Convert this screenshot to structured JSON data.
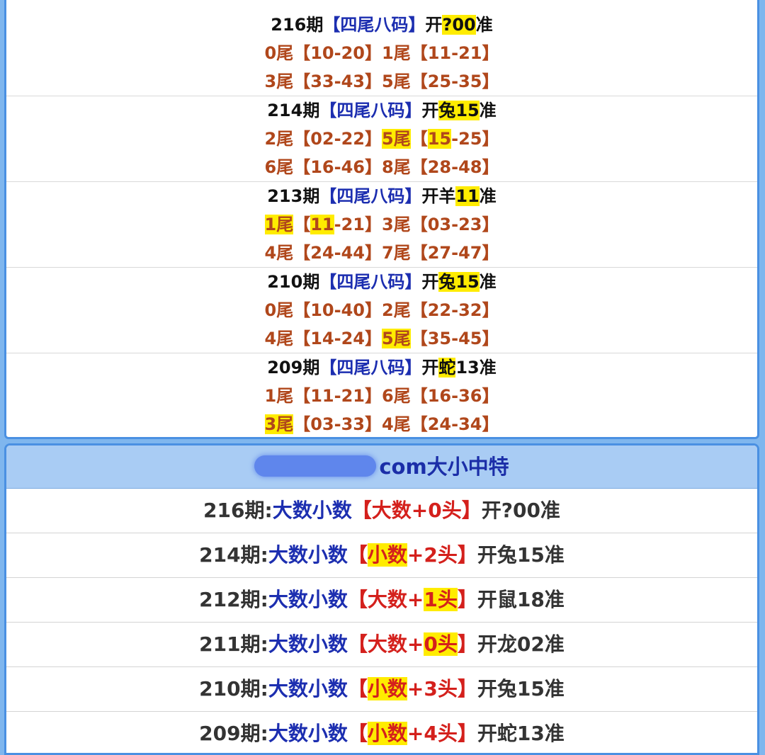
{
  "section1": {
    "blocks": [
      {
        "period": "216期",
        "tag": "【四尾八码】",
        "open_prefix": "开",
        "open_zodiac": "?",
        "open_num": "00",
        "open_suffix": "准",
        "row1": {
          "a_label": "0尾",
          "a_range_lb": "【",
          "a_range_hl": "",
          "a_range_rest": "10-20】",
          "b_label": "1尾",
          "b_range_lb": "【",
          "b_range_hl": "",
          "b_range_rest": "11-21】"
        },
        "row2": {
          "a_label": "3尾",
          "a_range_lb": "【",
          "a_range_hl": "",
          "a_range_rest": "33-43】",
          "b_label": "5尾",
          "b_range_lb": "【",
          "b_range_hl": "",
          "b_range_rest": "25-35】"
        }
      },
      {
        "period": "214期",
        "tag": "【四尾八码】",
        "open_prefix": "开",
        "open_zodiac": "兔",
        "open_num": "15",
        "open_suffix": "准",
        "row1": {
          "a_label": "2尾",
          "a_range_lb": "【",
          "a_range_hl": "",
          "a_range_rest": "02-22】",
          "b_label": "5尾",
          "b_range_lb": "【",
          "b_range_hl": "15",
          "b_range_rest": "-25】"
        },
        "row2": {
          "a_label": "6尾",
          "a_range_lb": "【",
          "a_range_hl": "",
          "a_range_rest": "16-46】",
          "b_label": "8尾",
          "b_range_lb": "【",
          "b_range_hl": "",
          "b_range_rest": "28-48】"
        }
      },
      {
        "period": "213期",
        "tag": "【四尾八码】",
        "open_prefix": "开",
        "open_zodiac": "羊",
        "open_num": "11",
        "open_suffix": "准",
        "row1": {
          "a_label": "1尾",
          "a_range_lb": "【",
          "a_range_hl": "11",
          "a_range_rest": "-21】",
          "b_label": "3尾",
          "b_range_lb": "【",
          "b_range_hl": "",
          "b_range_rest": "03-23】"
        },
        "row2": {
          "a_label": "4尾",
          "a_range_lb": "【",
          "a_range_hl": "",
          "a_range_rest": "24-44】",
          "b_label": "7尾",
          "b_range_lb": "【",
          "b_range_hl": "",
          "b_range_rest": "27-47】"
        }
      },
      {
        "period": "210期",
        "tag": "【四尾八码】",
        "open_prefix": "开",
        "open_zodiac": "兔",
        "open_num": "15",
        "open_suffix": "准",
        "row1": {
          "a_label": "0尾",
          "a_range_lb": "【",
          "a_range_hl": "",
          "a_range_rest": "10-40】",
          "b_label": "2尾",
          "b_range_lb": "【",
          "b_range_hl": "",
          "b_range_rest": "22-32】"
        },
        "row2": {
          "a_label": "4尾",
          "a_range_lb": "【",
          "a_range_hl": "",
          "a_range_rest": "14-24】",
          "b_label": "5尾",
          "b_range_lb": "【",
          "b_range_hl": "",
          "b_range_rest": "35-45】"
        }
      },
      {
        "period": "209期",
        "tag": "【四尾八码】",
        "open_prefix": "开",
        "open_zodiac": "蛇",
        "open_num": "13",
        "open_suffix": "准",
        "row1": {
          "a_label": "1尾",
          "a_range_lb": "【",
          "a_range_hl": "",
          "a_range_rest": "11-21】",
          "b_label": "6尾",
          "b_range_lb": "【",
          "b_range_hl": "",
          "b_range_rest": "16-36】"
        },
        "row2": {
          "a_label": "3尾",
          "a_range_lb": "【",
          "a_range_hl": "",
          "a_range_rest": "03-33】",
          "b_label": "4尾",
          "b_range_lb": "【",
          "b_range_hl": "",
          "b_range_rest": "24-34】"
        }
      }
    ]
  },
  "section2": {
    "title_suffix": "com大小中特",
    "rows": [
      {
        "period": "216期:",
        "label": "大数小数",
        "lb": "【",
        "pick_a": "大数",
        "plus": "+",
        "pick_b": "0头",
        "rb": "】",
        "result": "开?00准"
      },
      {
        "period": "214期:",
        "label": "大数小数",
        "lb": "【",
        "pick_a": "小数",
        "plus": "+",
        "pick_b": "2头",
        "rb": "】",
        "result": "开兔15准"
      },
      {
        "period": "212期:",
        "label": "大数小数",
        "lb": "【",
        "pick_a": "大数",
        "plus": "+",
        "pick_b": "1头",
        "rb": "】",
        "result": "开鼠18准"
      },
      {
        "period": "211期:",
        "label": "大数小数",
        "lb": "【",
        "pick_a": "大数",
        "plus": "+",
        "pick_b": "0头",
        "rb": "】",
        "result": "开龙02准"
      },
      {
        "period": "210期:",
        "label": "大数小数",
        "lb": "【",
        "pick_a": "小数",
        "plus": "+",
        "pick_b": "3头",
        "rb": "】",
        "result": "开兔15准"
      },
      {
        "period": "209期:",
        "label": "大数小数",
        "lb": "【",
        "pick_a": "小数",
        "plus": "+",
        "pick_b": "4头",
        "rb": "】",
        "result": "开蛇13准"
      }
    ]
  },
  "colors": {
    "frame_blue": "#4a90e2",
    "header_blue": "#a9ccf4",
    "text_blue": "#1c2eb0",
    "text_brown": "#b0471b",
    "text_red": "#d4201c",
    "highlight": "#ffec00"
  }
}
